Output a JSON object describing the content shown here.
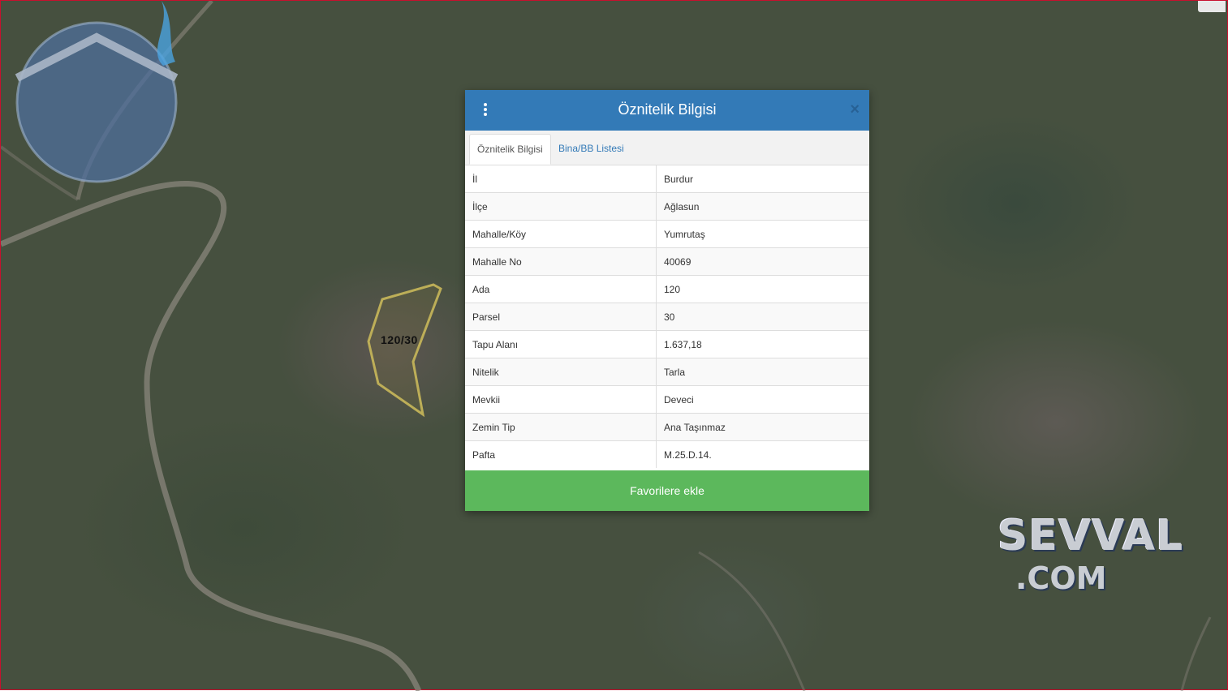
{
  "map": {
    "parcel_label": "120/30",
    "watermark_line1": "SEVVAL",
    "watermark_line2": ".COM"
  },
  "modal": {
    "title": "Öznitelik Bilgisi",
    "menu_icon": "kebab-menu-icon",
    "close_symbol": "×",
    "tabs": [
      {
        "label": "Öznitelik Bilgisi",
        "active": true
      },
      {
        "label": "Bina/BB Listesi",
        "active": false
      }
    ],
    "rows": [
      {
        "key": "İl",
        "value": "Burdur"
      },
      {
        "key": "İlçe",
        "value": "Ağlasun"
      },
      {
        "key": "Mahalle/Köy",
        "value": "Yumrutaş"
      },
      {
        "key": "Mahalle No",
        "value": "40069"
      },
      {
        "key": "Ada",
        "value": "120"
      },
      {
        "key": "Parsel",
        "value": "30"
      },
      {
        "key": "Tapu Alanı",
        "value": "1.637,18"
      },
      {
        "key": "Nitelik",
        "value": "Tarla"
      },
      {
        "key": "Mevkii",
        "value": "Deveci"
      },
      {
        "key": "Zemin Tip",
        "value": "Ana Taşınmaz"
      },
      {
        "key": "Pafta",
        "value": "M.25.D.14."
      }
    ],
    "favorite_button": "Favorilere ekle"
  },
  "colors": {
    "header": "#337ab7",
    "button": "#5cb85c",
    "parcel_outline": "#c9b85a"
  }
}
